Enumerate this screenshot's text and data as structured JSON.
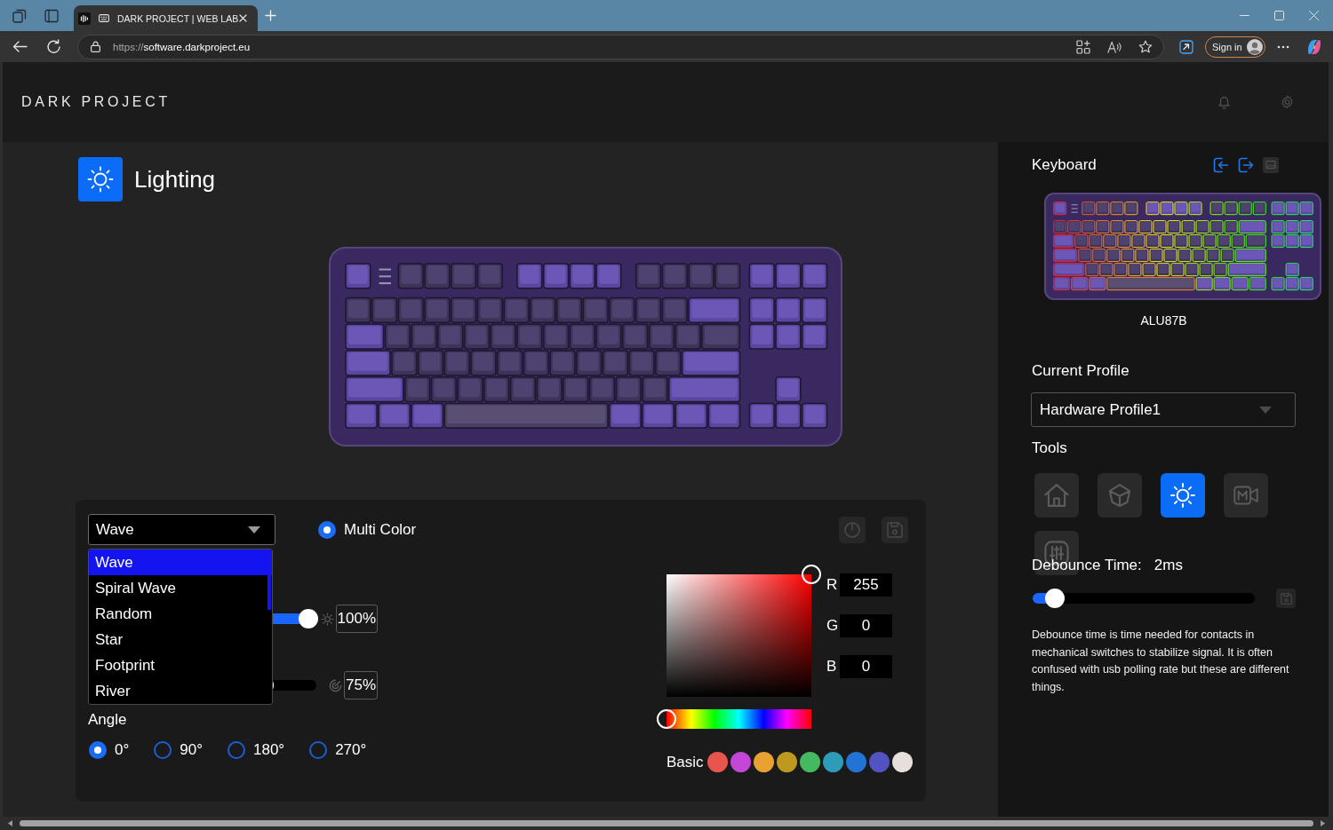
{
  "browser": {
    "tab_title": "DARK PROJECT | WEB LAB",
    "url_scheme": "https://",
    "url_host": "software.darkproject.eu",
    "sign_in": "Sign in"
  },
  "header": {
    "brand": "DARK PROJECT"
  },
  "page": {
    "title": "Lighting"
  },
  "effects": {
    "select": {
      "value": "Wave",
      "expanded": true
    },
    "options": [
      {
        "label": "Wave",
        "selected": true
      },
      {
        "label": "Spiral Wave",
        "selected": false
      },
      {
        "label": "Random",
        "selected": false
      },
      {
        "label": "Star",
        "selected": false
      },
      {
        "label": "Footprint",
        "selected": false
      },
      {
        "label": "River",
        "selected": false
      }
    ],
    "mode": {
      "label": "Multi Color",
      "checked": true
    },
    "sliders": [
      {
        "kind": "brightness",
        "level": 1,
        "reading": "100%"
      },
      {
        "kind": "speed",
        "level": 0.75,
        "reading": "75%"
      }
    ],
    "angle": {
      "label": "Angle",
      "options": [
        {
          "label": "0°",
          "selected": true
        },
        {
          "label": "90°",
          "selected": false
        },
        {
          "label": "180°",
          "selected": false
        },
        {
          "label": "270°",
          "selected": false
        }
      ]
    }
  },
  "color_picker": {
    "channels": [
      {
        "label": "R",
        "value": "255"
      },
      {
        "label": "G",
        "value": "0"
      },
      {
        "label": "B",
        "value": "0"
      }
    ],
    "basic_label": "Basic",
    "swatches": [
      {
        "color": "#e8554c"
      },
      {
        "color": "#c445d6"
      },
      {
        "color": "#e9a132"
      },
      {
        "color": "#bd9a1f"
      },
      {
        "color": "#44b95f"
      },
      {
        "color": "#2d9cb9"
      },
      {
        "color": "#2174d5"
      },
      {
        "color": "#5252c2"
      },
      {
        "color": "#e7dfdc"
      }
    ]
  },
  "sidebar": {
    "title": "Keyboard",
    "device": "ALU87B",
    "profile_label": "Current Profile",
    "profile": "Hardware Profile1",
    "tools_label": "Tools",
    "tools": [
      {
        "kind": "home",
        "selected": false
      },
      {
        "kind": "keycap",
        "selected": false
      },
      {
        "kind": "lighting",
        "selected": true
      },
      {
        "kind": "macro",
        "selected": false
      },
      {
        "kind": "tuning",
        "selected": false
      }
    ],
    "debounce": {
      "label": "Debounce Time:",
      "value": "2ms",
      "level": 0.1
    },
    "note": "Debounce time is time needed for contacts in mechanical switches to stabilize signal. It is often confused with usb polling rate but these are different things."
  }
}
